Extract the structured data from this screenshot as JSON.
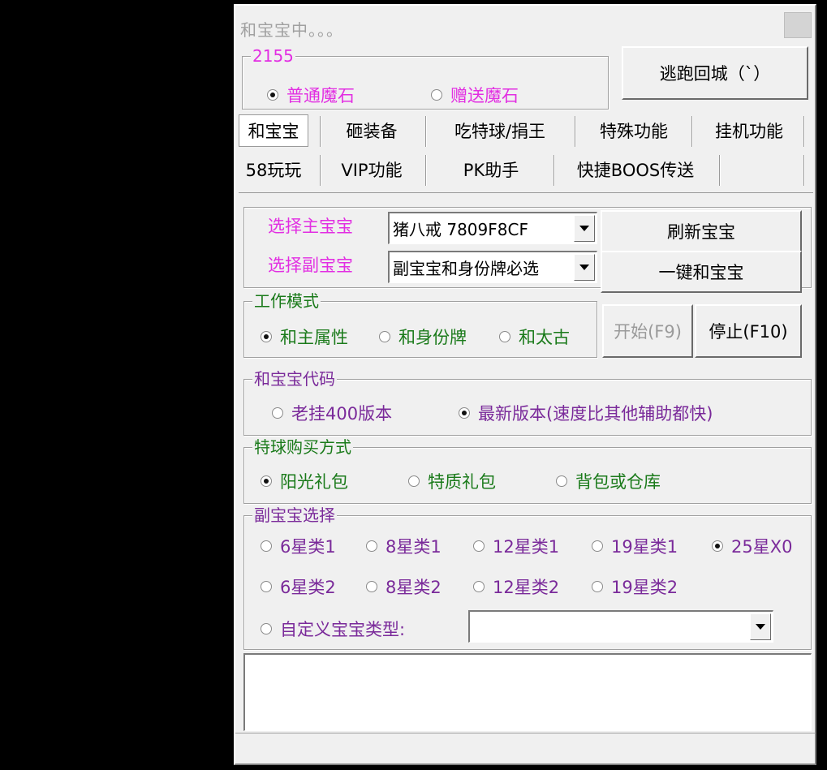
{
  "colors": {
    "magenta": "#e22ee2",
    "green": "#1a7a1a",
    "purple": "#7a2a9a",
    "title": "#a0a0a0"
  },
  "window": {
    "title": "和宝宝中。。。"
  },
  "stone_group": {
    "legend": "2155",
    "normal": "普通魔石",
    "gift": "赠送魔石",
    "selected": "normal"
  },
  "escape_button": "逃跑回城（`）",
  "tabs_row1": [
    "和宝宝",
    "砸装备",
    "吃特球/捐王",
    "特殊功能",
    "挂机功能"
  ],
  "tabs_row2": [
    "58玩玩",
    "VIP功能",
    "PK助手",
    "快捷BOOS传送"
  ],
  "active_tab": "和宝宝",
  "main_pet": {
    "label": "选择主宝宝",
    "value": "猪八戒 7809F8CF"
  },
  "sub_pet": {
    "label": "选择副宝宝",
    "value": "副宝宝和身份牌必选"
  },
  "refresh_button": "刷新宝宝",
  "one_key_button": "一键和宝宝",
  "work_mode": {
    "legend": "工作模式",
    "options": [
      "和主属性",
      "和身份牌",
      "和太古"
    ],
    "selected": 0
  },
  "start_button": "开始(F9)",
  "stop_button": "停止(F10)",
  "code_group": {
    "legend": "和宝宝代码",
    "options": [
      "老挂400版本",
      "最新版本(速度比其他辅助都快)"
    ],
    "selected": 1
  },
  "buy_group": {
    "legend": "特球购买方式",
    "options": [
      "阳光礼包",
      "特质礼包",
      "背包或仓库"
    ],
    "selected": 0
  },
  "sub_select": {
    "legend": "副宝宝选择",
    "row1": [
      "6星类1",
      "8星类1",
      "12星类1",
      "19星类1",
      "25星X0"
    ],
    "row2": [
      "6星类2",
      "8星类2",
      "12星类2",
      "19星类2"
    ],
    "custom": "自定义宝宝类型:",
    "custom_value": "",
    "selected": "25星X0"
  }
}
